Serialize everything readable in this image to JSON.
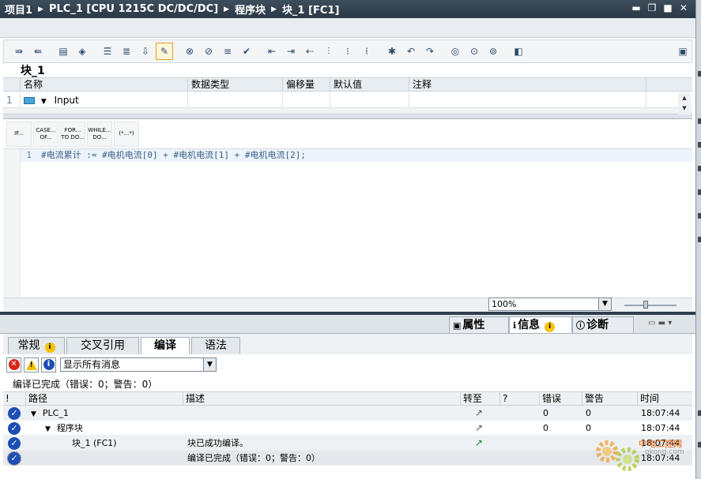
{
  "titlebar": {
    "crumbs": [
      "项目1",
      "PLC_1 [CPU 1215C DC/DC/DC]",
      "程序块",
      "块_1 [FC1]"
    ],
    "separator": "▶",
    "win_buttons": [
      "▬",
      "❐",
      "■",
      "✕"
    ]
  },
  "block": {
    "name": "块_1"
  },
  "interface": {
    "headers": [
      "名称",
      "数据类型",
      "偏移量",
      "默认值",
      "注释"
    ],
    "row_number": "1",
    "row_name": "Input"
  },
  "scl_toolbox": [
    "IF...",
    "CASE...\nOF...",
    "FOR...\nTO DO...",
    "WHILE...\nDO...",
    "(*...*)"
  ],
  "code": {
    "line_number": "1",
    "text": "#电流累计 := #电机电流[0] + #电机电流[1] + #电机电流[2];"
  },
  "zoom": {
    "value": "100%"
  },
  "inspector": {
    "tabs": [
      "属性",
      "信息",
      "诊断"
    ],
    "info_badge": "i"
  },
  "subtabs": [
    "常规",
    "交叉引用",
    "编译",
    "语法"
  ],
  "filter": {
    "selected": "显示所有消息"
  },
  "status_text": "编译已完成（错误：0；警告：0）",
  "messages": {
    "headers": [
      "!",
      "路径",
      "描述",
      "转至",
      "?",
      "错误",
      "警告",
      "时间"
    ],
    "rows": [
      {
        "path": "PLC_1",
        "desc": "",
        "goto": "↗",
        "errors": "0",
        "warnings": "0",
        "time": "18:07:44"
      },
      {
        "path": "程序块",
        "desc": "",
        "goto": "↗",
        "errors": "0",
        "warnings": "0",
        "time": "18:07:44"
      },
      {
        "path": "块_1 (FC1)",
        "desc": "块已成功编译。",
        "goto": "↗",
        "errors": "",
        "warnings": "",
        "time": "18:07:44"
      },
      {
        "path": "",
        "desc": "编译已完成（错误：0；警告：0）",
        "goto": "",
        "errors": "",
        "warnings": "",
        "time": "18:07:44"
      }
    ]
  },
  "watermark": {
    "line1": "中电工控网",
    "line2": "gkong.com"
  },
  "colors": {
    "titlebar": "#2f3e4c",
    "code_text": "#3c5e86",
    "ok_icon": "#1c4fb3",
    "goto_green": "#1d8a2e"
  }
}
